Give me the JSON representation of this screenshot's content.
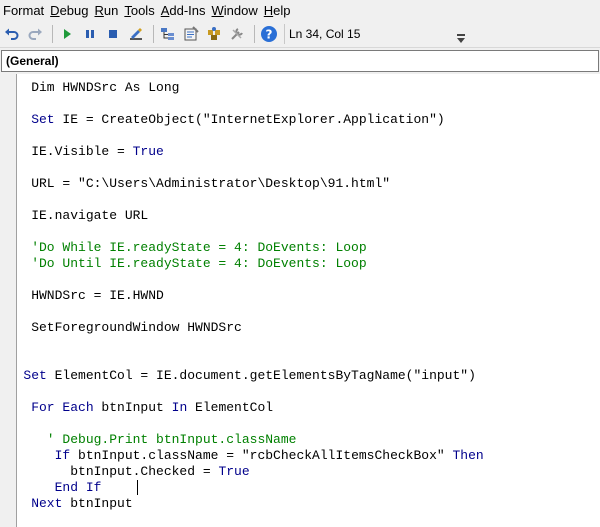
{
  "menubar": {
    "items": [
      {
        "label": "Format",
        "accel": ""
      },
      {
        "label": "Debug",
        "accel": "D"
      },
      {
        "label": "Run",
        "accel": "R"
      },
      {
        "label": "Tools",
        "accel": "T"
      },
      {
        "label": "Add-Ins",
        "accel": "A"
      },
      {
        "label": "Window",
        "accel": "W"
      },
      {
        "label": "Help",
        "accel": "H"
      }
    ]
  },
  "toolbar": {
    "icons": [
      "undo-icon",
      "redo-icon",
      "run-icon",
      "break-icon",
      "reset-icon",
      "design-mode-icon",
      "project-explorer-icon",
      "properties-icon",
      "object-browser-icon",
      "toolbox-icon",
      "help-icon"
    ],
    "cursor_position": "Ln 34, Col 15"
  },
  "procedure_combo": {
    "value": "(General)"
  },
  "colors": {
    "keyword": "#00008b",
    "comment": "#008000",
    "text": "#000000"
  },
  "code": {
    "lines": [
      {
        "tokens": [
          {
            "t": "    Dim HWNDSrc As Long",
            "k": ""
          }
        ]
      },
      {
        "tokens": [
          {
            "t": "    Set",
            "k": "kw"
          },
          {
            "t": " IE = CreateObject(\"InternetExplorer.Application\")",
            "k": ""
          }
        ]
      },
      {
        "tokens": [
          {
            "t": "    IE.Visible = ",
            "k": ""
          },
          {
            "t": "True",
            "k": "kw"
          }
        ]
      },
      {
        "tokens": [
          {
            "t": "    URL = \"C:\\Users\\Administrator\\Desktop\\91.html\"",
            "k": ""
          }
        ]
      },
      {
        "tokens": [
          {
            "t": "    IE.navigate URL",
            "k": ""
          }
        ]
      },
      {
        "tokens": [
          {
            "t": "    'Do While IE.readyState = 4: DoEvents: Loop",
            "k": "cm"
          }
        ]
      },
      {
        "tokens": [
          {
            "t": "    'Do Until IE.readyState = 4: DoEvents: Loop",
            "k": "cm"
          }
        ]
      },
      {
        "tokens": [
          {
            "t": "    HWNDSrc = IE.HWND",
            "k": ""
          }
        ]
      },
      {
        "tokens": [
          {
            "t": "    SetForegroundWindow HWNDSrc",
            "k": ""
          }
        ]
      },
      {
        "tokens": [
          {
            "t": "   Set",
            "k": "kw"
          },
          {
            "t": " ElementCol = IE.document.getElementsByTagName(\"input\")",
            "k": ""
          }
        ]
      },
      {
        "tokens": [
          {
            "t": "    For Each",
            "k": "kw"
          },
          {
            "t": " btnInput ",
            "k": ""
          },
          {
            "t": "In",
            "k": "kw"
          },
          {
            "t": " ElementCol",
            "k": ""
          }
        ]
      },
      {
        "tokens": [
          {
            "t": "      ' Debug.Print btnInput.className",
            "k": "cm"
          }
        ]
      },
      {
        "tokens": [
          {
            "t": "       If",
            "k": "kw"
          },
          {
            "t": " btnInput.className = \"rcbCheckAllItemsCheckBox\" ",
            "k": ""
          },
          {
            "t": "Then",
            "k": "kw"
          }
        ]
      },
      {
        "tokens": [
          {
            "t": "         btnInput.Checked = ",
            "k": ""
          },
          {
            "t": "True",
            "k": "kw"
          }
        ]
      },
      {
        "tokens": [
          {
            "t": "       End If",
            "k": "kw"
          }
        ]
      },
      {
        "tokens": [
          {
            "t": "    Next",
            "k": "kw"
          },
          {
            "t": " btnInput",
            "k": ""
          }
        ]
      }
    ]
  }
}
